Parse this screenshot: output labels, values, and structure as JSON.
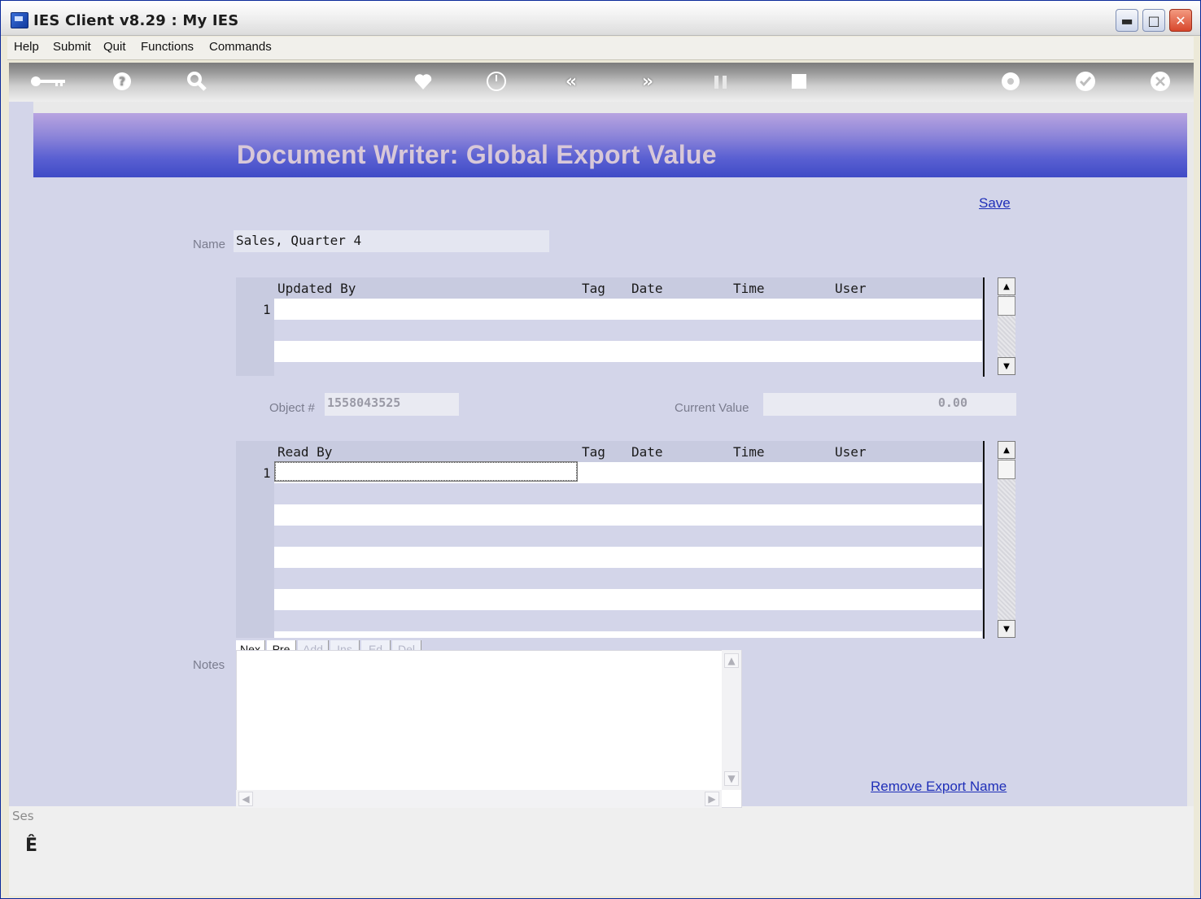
{
  "window": {
    "title": "IES Client v8.29 : My IES"
  },
  "menu": [
    "Help",
    "Submit",
    "Quit",
    "Functions",
    "Commands"
  ],
  "toolbar_icons": [
    "key-icon",
    "help-icon",
    "search-icon",
    "heart-icon",
    "clock-icon",
    "rewind-icon",
    "fast-forward-icon",
    "pause-icon",
    "stop-icon",
    "recycle-icon",
    "check-icon",
    "close-icon"
  ],
  "header": {
    "title": "Document Writer: Global Export Value"
  },
  "actions": {
    "save": "Save",
    "remove": "Remove Export Name"
  },
  "form": {
    "name_label": "Name",
    "name_value": "Sales, Quarter 4",
    "object_label": "Object #",
    "object_value": "1558043525",
    "current_value_label": "Current Value",
    "current_value": "0.00",
    "notes_label": "Notes"
  },
  "updated_grid": {
    "columns": [
      "Updated By",
      "Tag",
      "Date",
      "Time",
      "User"
    ],
    "row_number": "1"
  },
  "read_grid": {
    "columns": [
      "Read By",
      "Tag",
      "Date",
      "Time",
      "User"
    ],
    "row_number": "1"
  },
  "note_buttons": [
    "Nex",
    "Pre",
    "Add",
    "Ins",
    "Ed",
    "Del"
  ],
  "status": {
    "session_text": "Ses",
    "icon_glyph": "Ê"
  },
  "colors": {
    "header_start": "#b8a4e0",
    "header_end": "#3f4bc6",
    "panel": "#d3d5e9",
    "link": "#1f2fb8"
  }
}
